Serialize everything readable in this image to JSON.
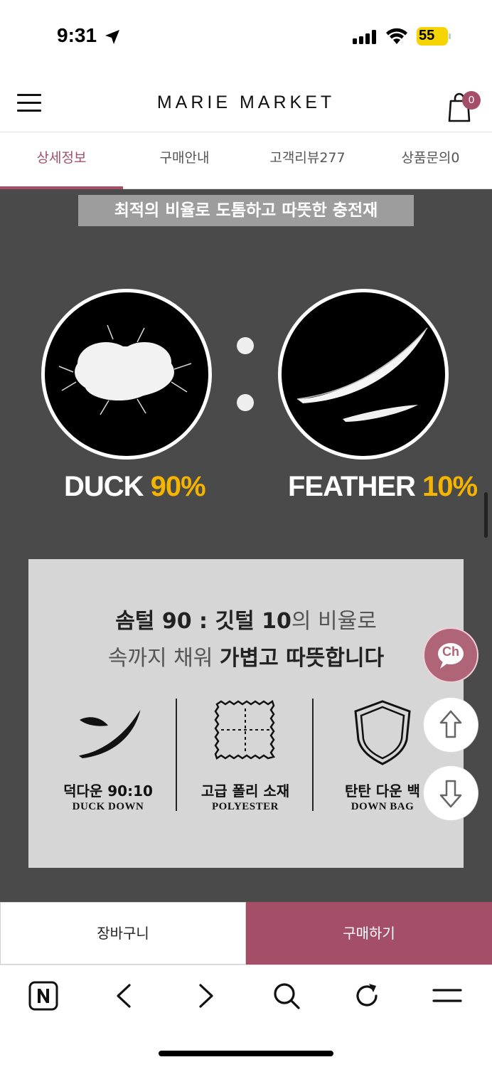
{
  "status_bar": {
    "time": "9:31",
    "battery": "55"
  },
  "header": {
    "brand": "MARIE MARKET",
    "cart_count": "0"
  },
  "tabs": [
    {
      "label": "상세정보",
      "active": true
    },
    {
      "label": "구매안내",
      "active": false
    },
    {
      "label": "고객리뷰277",
      "active": false
    },
    {
      "label": "상품문의0",
      "active": false
    }
  ],
  "content": {
    "headline": "최적의 비율로 도톰하고 따뜻한 충전재",
    "duck": {
      "word": "DUCK ",
      "percent": "90%"
    },
    "feather": {
      "word": "FEATHER ",
      "percent": "10%"
    },
    "info": {
      "line1_bold_a": "솜털 90 : 깃털 10",
      "line1_light": "의 비율로",
      "line2_light": "속까지 채워 ",
      "line2_bold": "가볍고 따뜻합니다"
    },
    "features": [
      {
        "title": "덕다운 90:10",
        "subtitle": "DUCK DOWN",
        "icon": "feather-icon"
      },
      {
        "title": "고급 폴리 소재",
        "subtitle": "POLYESTER",
        "icon": "fabric-swatch-icon"
      },
      {
        "title": "탄탄 다운 백",
        "subtitle": "DOWN BAG",
        "icon": "shield-icon"
      }
    ]
  },
  "floating": {
    "chat_label": "Ch"
  },
  "actions": {
    "cart_label": "장바구니",
    "buy_label": "구매하기"
  },
  "colors": {
    "accent": "#a54e68",
    "content_bg": "#4a4a4a",
    "percent_yellow": "#f5b400",
    "battery_yellow": "#f5d400"
  }
}
